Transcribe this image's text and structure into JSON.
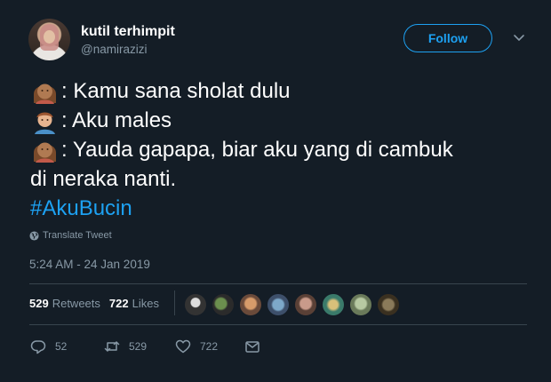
{
  "user": {
    "display_name": "kutil terhimpit",
    "handle": "@namirazizi"
  },
  "header": {
    "follow_label": "Follow"
  },
  "tweet": {
    "lines": [
      {
        "emoji": "woman-emoji",
        "text": ": Kamu sana sholat dulu"
      },
      {
        "emoji": "man-emoji",
        "text": ": Aku males"
      },
      {
        "emoji": "woman-emoji",
        "text": ": Yauda gapapa, biar aku yang di cambuk"
      }
    ],
    "continuation": "di neraka nanti.",
    "hashtag": "#AkuBucin"
  },
  "translate_label": "Translate Tweet",
  "timestamp": "5:24 AM - 24 Jan 2019",
  "stats": {
    "retweets_count": "529",
    "retweets_label": "Retweets",
    "likes_count": "722",
    "likes_label": "Likes"
  },
  "actions": {
    "reply_count": "52",
    "retweet_count": "529",
    "like_count": "722"
  },
  "colors": {
    "background": "#141d26",
    "accent": "#1da1f2",
    "secondary_text": "#8899a6",
    "divider": "#38444d"
  }
}
